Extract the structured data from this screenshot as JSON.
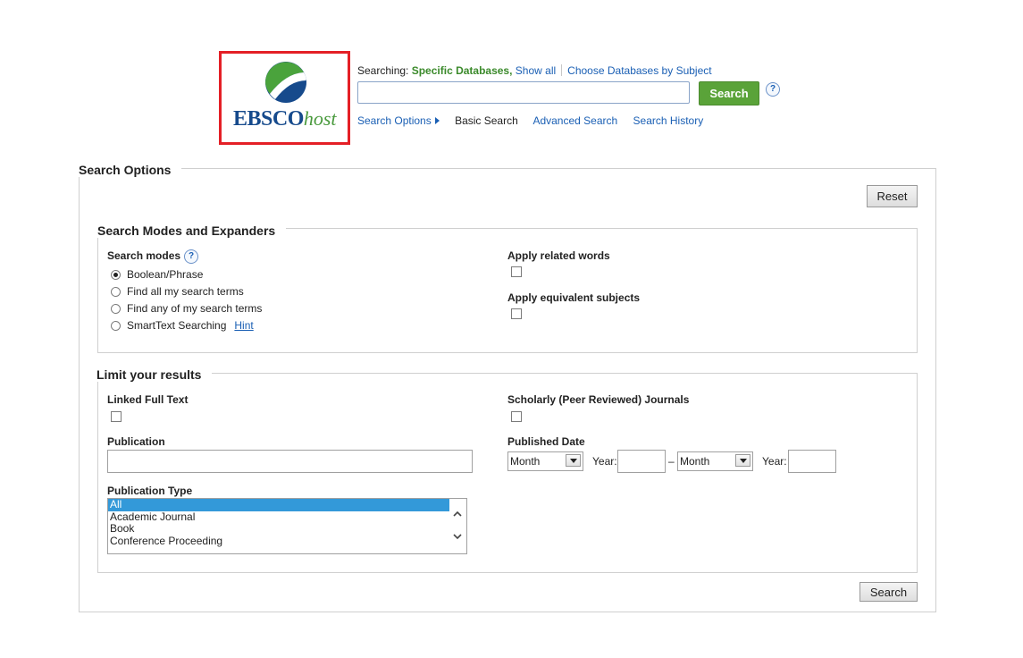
{
  "logo": {
    "brand": "EBSCO",
    "suffix": "host"
  },
  "header": {
    "searching_label": "Searching:",
    "database_selection": "Specific Databases,",
    "show_all": "Show all",
    "choose_databases": "Choose Databases by Subject",
    "search_input": {
      "value": "",
      "placeholder": ""
    },
    "search_button": "Search",
    "help": "?",
    "nav": {
      "search_options": "Search Options",
      "basic_search": "Basic Search",
      "advanced_search": "Advanced Search",
      "search_history": "Search History"
    }
  },
  "search_options": {
    "title": "Search Options",
    "reset_button": "Reset",
    "modes_expanders": {
      "title": "Search Modes and Expanders",
      "search_modes_label": "Search modes",
      "help": "?",
      "modes": [
        {
          "label": "Boolean/Phrase",
          "selected": true
        },
        {
          "label": "Find all my search terms",
          "selected": false
        },
        {
          "label": "Find any of my search terms",
          "selected": false
        },
        {
          "label": "SmartText Searching",
          "selected": false
        }
      ],
      "hint_link": "Hint",
      "apply_related_words": "Apply related words",
      "apply_equivalent_subjects": "Apply equivalent subjects"
    },
    "limits": {
      "title": "Limit your results",
      "linked_full_text": "Linked Full Text",
      "scholarly_journals": "Scholarly (Peer Reviewed) Journals",
      "publication_label": "Publication",
      "publication_value": "",
      "published_date_label": "Published Date",
      "month_from": "Month",
      "year_label_from": "Year:",
      "date_dash": "–",
      "month_to": "Month",
      "year_label_to": "Year:",
      "publication_type_label": "Publication Type",
      "publication_types": [
        "All",
        "Academic Journal",
        "Book",
        "Conference Proceeding"
      ],
      "publication_type_selected": "All"
    },
    "bottom_search_button": "Search"
  }
}
